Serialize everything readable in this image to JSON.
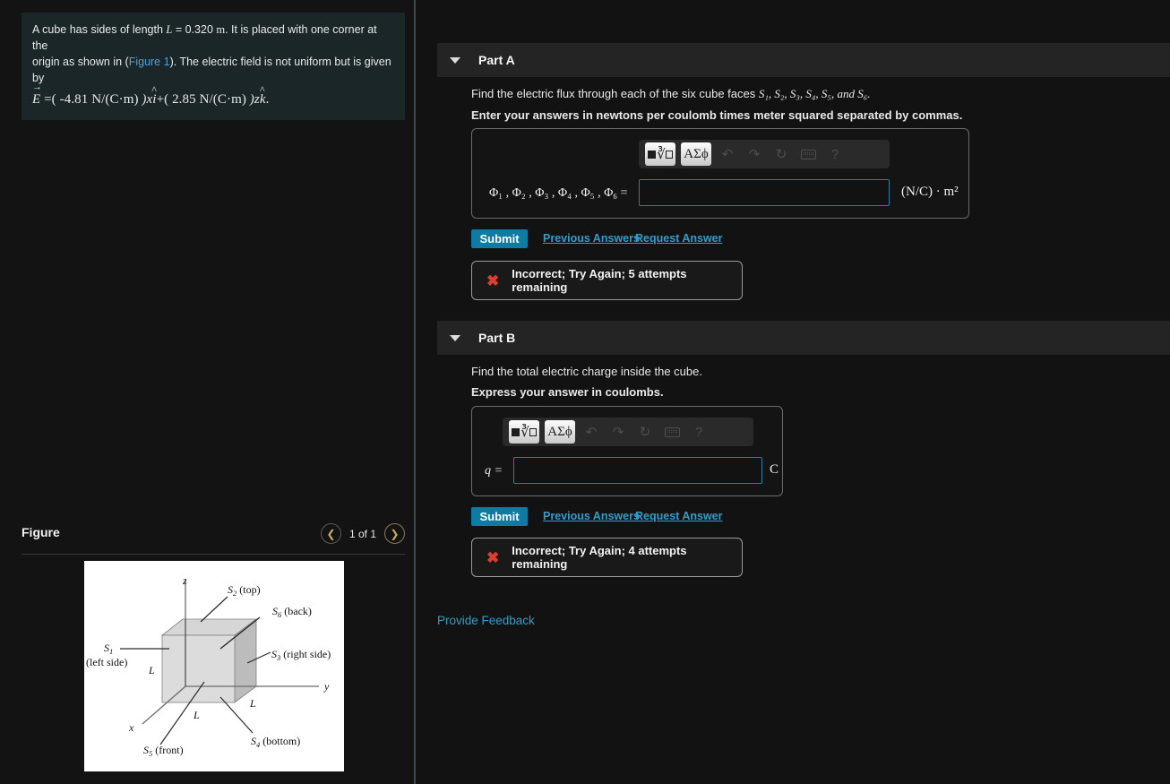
{
  "problem": {
    "line1_a": "A cube has sides of length ",
    "line1_L": "L",
    "line1_b": " = 0.320 ",
    "line1_unit": "m",
    "line1_c": ". It is placed with one corner at the",
    "line2_a": "origin as shown in (",
    "line2_link": "Figure 1",
    "line2_b": "). The electric field is not uniform but is given by",
    "equation": {
      "E": "E",
      "eq": " =( ",
      "coef1": "-4.81 N/(C·m)",
      "mid": " )x",
      "ihat": "i",
      "plus": "+( ",
      "coef2": "2.85 N/(C·m)",
      "mid2": " )z",
      "khat": "k",
      "period": "."
    }
  },
  "figure": {
    "title": "Figure",
    "count": "1 of 1",
    "prev_icon": "chevron-left-icon",
    "next_icon": "chevron-right-icon",
    "labels": {
      "z": "z",
      "y": "y",
      "x": "x",
      "s1": "S",
      "s1_sub": "1",
      "s1_note": "(left side)",
      "s2": "S",
      "s2_sub": "2",
      "s2_note": "(top)",
      "s3": "S",
      "s3_sub": "3",
      "s3_note": "(right side)",
      "s4": "S",
      "s4_sub": "4",
      "s4_note": "(bottom)",
      "s5": "S",
      "s5_sub": "5",
      "s5_note": "(front)",
      "s6": "S",
      "s6_sub": "6",
      "s6_note": "(back)",
      "L": "L"
    }
  },
  "partA": {
    "title": "Part A",
    "question": "Find the electric flux through each of the six cube faces ",
    "faces": "S₁, S₂, S₃, S₄, S₅, and S₆.",
    "instruction": "Enter your answers in newtons per coulomb times meter squared separated by commas.",
    "toolbar": {
      "template_btn": "template-icon",
      "greek_btn": "ΑΣϕ",
      "undo": "undo-icon",
      "redo": "redo-icon",
      "reset": "reset-icon",
      "keyboard": "keyboard-icon",
      "help": "?"
    },
    "field_label": "Φ₁ , Φ₂ , Φ₃ , Φ₄ , Φ₅ , Φ₆ =",
    "field_value": "",
    "units": "(N/C) · m²",
    "submit": "Submit",
    "previous_answers": "Previous Answers",
    "request_answer": "Request Answer",
    "alert_icon": "✖",
    "alert": "Incorrect; Try Again; 5 attempts remaining"
  },
  "partB": {
    "title": "Part B",
    "question": "Find the total electric charge inside the cube.",
    "instruction": "Express your answer in coulombs.",
    "toolbar": {
      "template_btn": "template-icon",
      "greek_btn": "ΑΣϕ",
      "undo": "undo-icon",
      "redo": "redo-icon",
      "reset": "reset-icon",
      "keyboard": "keyboard-icon",
      "help": "?"
    },
    "field_label": "q =",
    "field_value": "",
    "units": "C",
    "submit": "Submit",
    "previous_answers": "Previous Answers",
    "request_answer": "Request Answer",
    "alert_icon": "✖",
    "alert": "Incorrect; Try Again; 4 attempts remaining"
  },
  "footer": {
    "provide_feedback": "Provide Feedback"
  },
  "colors": {
    "accent": "#0f7ba3",
    "link": "#2f9ecb",
    "error": "#e33b2e",
    "input_border": "#2a7f9e",
    "panel": "#121212"
  }
}
